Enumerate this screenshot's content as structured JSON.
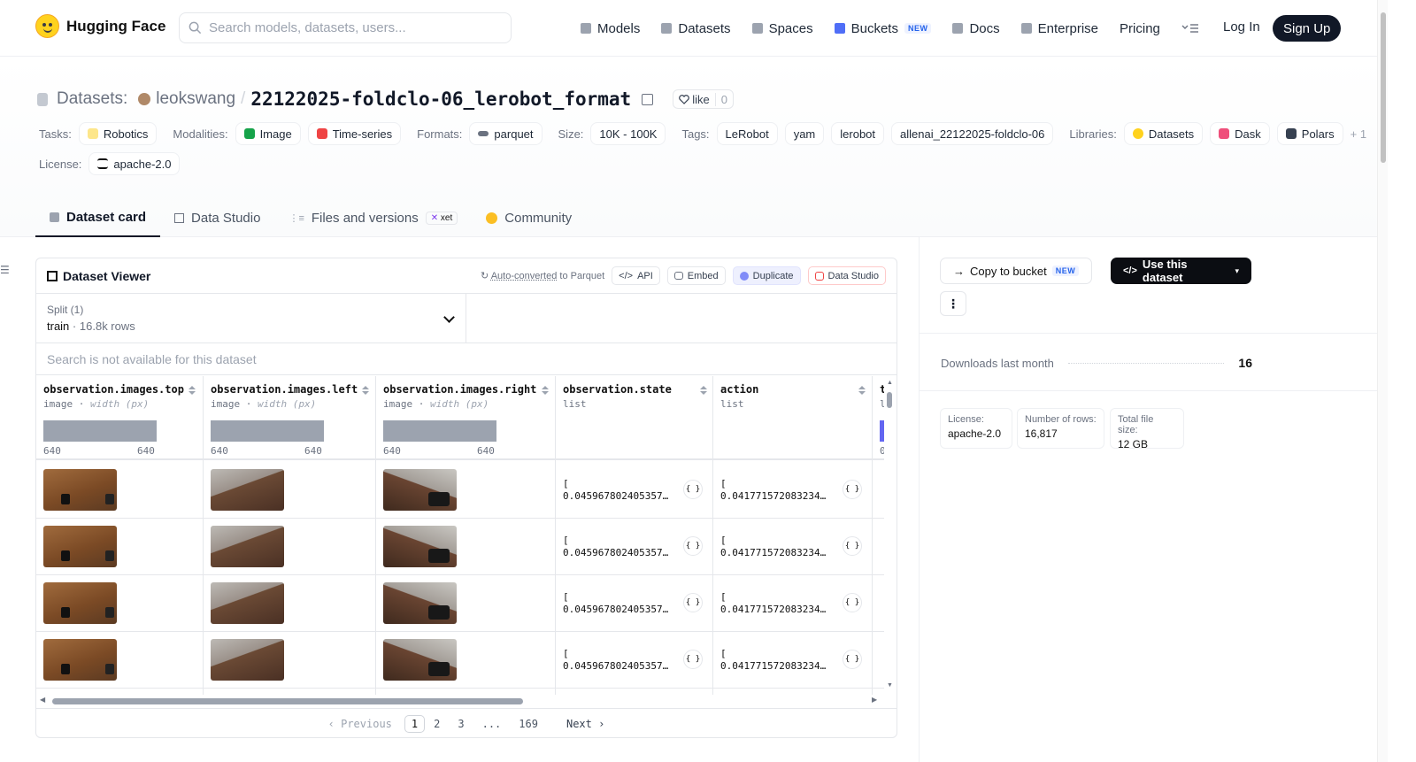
{
  "brand": {
    "name": "Hugging Face"
  },
  "search": {
    "placeholder": "Search models, datasets, users..."
  },
  "nav": {
    "items": [
      {
        "label": "Models"
      },
      {
        "label": "Datasets"
      },
      {
        "label": "Spaces"
      },
      {
        "label": "Buckets",
        "badge": "NEW"
      },
      {
        "label": "Docs"
      },
      {
        "label": "Enterprise"
      },
      {
        "label": "Pricing"
      }
    ],
    "login": "Log In",
    "signup": "Sign Up"
  },
  "header": {
    "section": "Datasets:",
    "owner": "leokswang",
    "separator": "/",
    "repo": "22122025-foldclo-06_lerobot_format",
    "like_label": "like",
    "like_count": "0"
  },
  "meta": {
    "tasks_label": "Tasks:",
    "tasks": [
      "Robotics"
    ],
    "modalities_label": "Modalities:",
    "modalities": [
      "Image",
      "Time-series"
    ],
    "formats_label": "Formats:",
    "formats": [
      "parquet"
    ],
    "size_label": "Size:",
    "size": [
      "10K - 100K"
    ],
    "tags_label": "Tags:",
    "tags": [
      "LeRobot",
      "yam",
      "lerobot",
      "allenai_22122025-foldclo-06"
    ],
    "libraries_label": "Libraries:",
    "libraries": [
      "Datasets",
      "Dask",
      "Polars"
    ],
    "libraries_more": "+ 1",
    "license_label": "License:",
    "license": "apache-2.0"
  },
  "tabs": [
    {
      "label": "Dataset card",
      "active": true
    },
    {
      "label": "Data Studio"
    },
    {
      "label": "Files and versions",
      "badge": "xet"
    },
    {
      "label": "Community"
    }
  ],
  "viewer": {
    "title": "Dataset Viewer",
    "auto_converted": "Auto-converted",
    "to_parquet": "to Parquet",
    "buttons": [
      "API",
      "Embed",
      "Duplicate",
      "Data Studio"
    ],
    "split_label": "Split (1)",
    "split_value": "train",
    "split_dot": "·",
    "split_rows": "16.8k rows",
    "search_na": "Search is not available for this dataset",
    "columns": [
      {
        "name": "observation.images.top",
        "type": "image",
        "sub": "width (px)",
        "min": "640",
        "max": "640"
      },
      {
        "name": "observation.images.left",
        "type": "image",
        "sub": "width (px)",
        "min": "640",
        "max": "640"
      },
      {
        "name": "observation.images.right",
        "type": "image",
        "sub": "width (px)",
        "min": "640",
        "max": "640"
      },
      {
        "name": "observation.state",
        "type": "list"
      },
      {
        "name": "action",
        "type": "list"
      },
      {
        "name": "t",
        "type": "l",
        "min": "0"
      }
    ],
    "rows": [
      {
        "state": "[\n0.045967802405357…",
        "action": "[\n0.041771572083234…"
      },
      {
        "state": "[\n0.045967802405357…",
        "action": "[\n0.041771572083234…"
      },
      {
        "state": "[\n0.045967802405357…",
        "action": "[\n0.041771572083234…"
      },
      {
        "state": "[\n0.045967802405357…",
        "action": "[\n0.041771572083234…"
      }
    ],
    "json_btn": "{ }",
    "pager": {
      "prev": "Previous",
      "pages": [
        "1",
        "2",
        "3",
        "...",
        "169"
      ],
      "next": "Next",
      "current": "1"
    }
  },
  "right_panel": {
    "copy_bucket": "Copy to bucket",
    "copy_badge": "NEW",
    "use_dataset": "Use this dataset",
    "downloads_label": "Downloads last month",
    "downloads_value": "16",
    "stats": [
      {
        "label": "License:",
        "value": "apache-2.0"
      },
      {
        "label": "Number of rows:",
        "value": "16,817"
      },
      {
        "label": "Total file size:",
        "value": "12 GB"
      }
    ]
  }
}
